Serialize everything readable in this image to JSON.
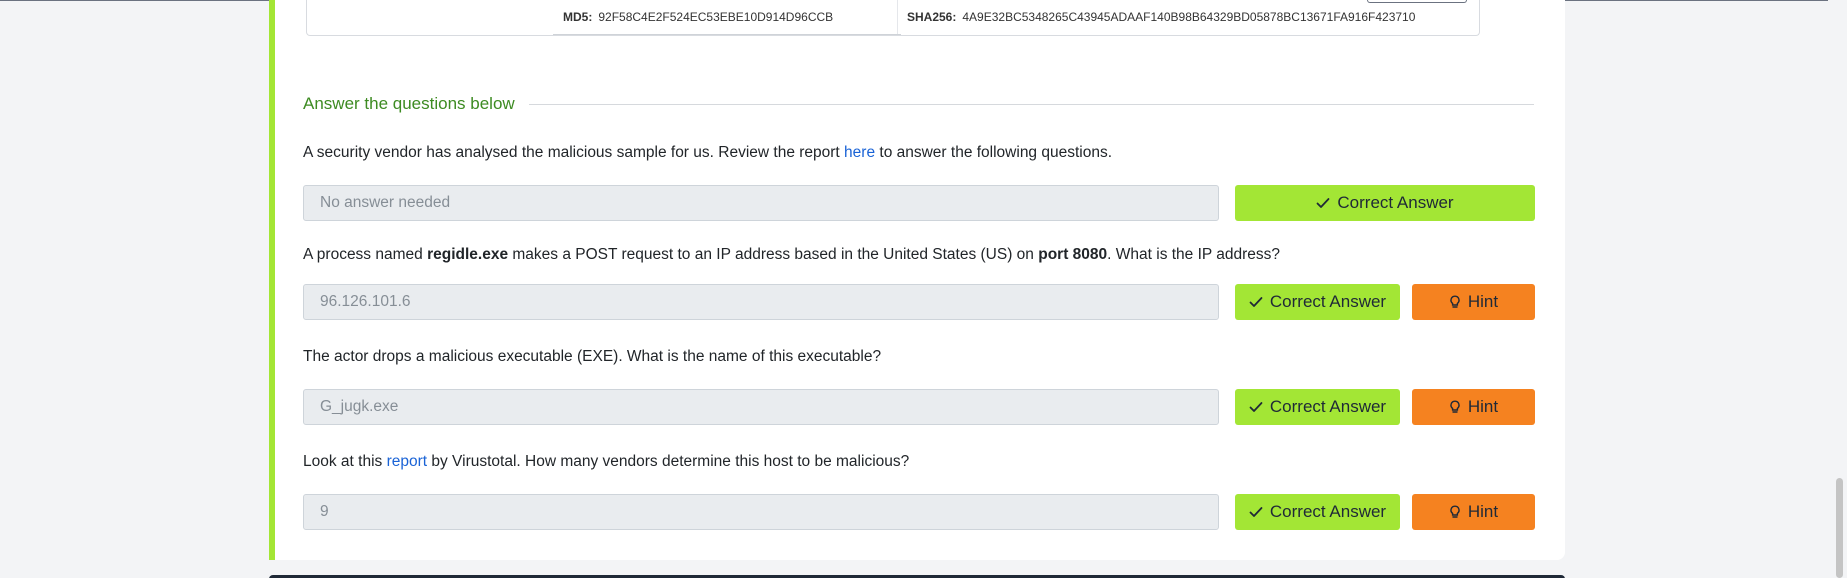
{
  "hash_box": {
    "md5_label": "MD5:",
    "md5_value": "92F58C4E2F524EC53EBE10D914D96CCB",
    "sha256_label": "SHA256:",
    "sha256_value": "4A9E32BC5348265C43945ADAAF140B98B64329BD05878BC13671FA916F423710"
  },
  "section": {
    "title": "Answer the questions below"
  },
  "questions": [
    {
      "text_before": "A security vendor has analysed the malicious sample for us. Review the report ",
      "link_text": "here",
      "text_after": " to answer the following questions.",
      "answer": "No answer needed",
      "correct_label": "Correct Answer"
    },
    {
      "text_1": "A process named ",
      "bold_1": "regidle.exe",
      "text_2": " makes a POST request to an IP address based in the United States (US) on ",
      "bold_2": "port 8080",
      "text_3": ". What is the IP address?",
      "answer": "96.126.101.6",
      "correct_label": "Correct Answer",
      "hint_label": "Hint"
    },
    {
      "text": "The actor drops a malicious executable (EXE). What is the name of this executable?",
      "answer": "G_jugk.exe",
      "correct_label": "Correct Answer",
      "hint_label": "Hint"
    },
    {
      "text_before": "Look at this ",
      "link_text": "report",
      "text_after": " by Virustotal. How many vendors determine this host to be malicious?",
      "answer": "9",
      "correct_label": "Correct Answer",
      "hint_label": "Hint"
    }
  ],
  "icons": {
    "check": "check-icon",
    "hint": "lightbulb-icon"
  },
  "colors": {
    "accent_green": "#a3e635",
    "hint_orange": "#f58220",
    "section_green": "#3d8b22",
    "link_blue": "#1a63d6"
  }
}
